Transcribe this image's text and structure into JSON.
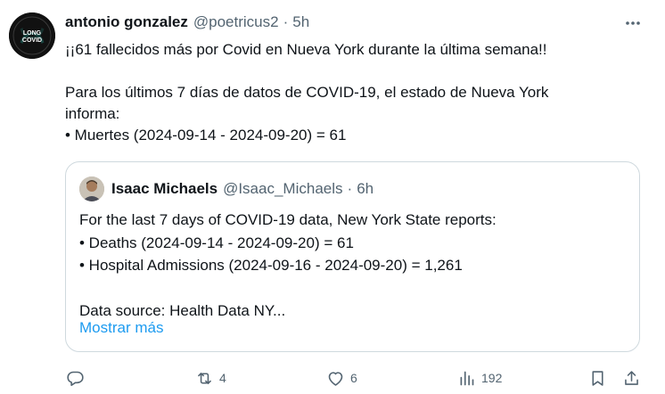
{
  "tweet": {
    "author_name": "antonio gonzalez",
    "author_handle": "@poetricus2",
    "separator": "·",
    "timestamp": "5h",
    "avatar_text": {
      "top": "LONG",
      "bottom": "COVID"
    },
    "text_lines": [
      "¡¡61 fallecidos más por Covid en Nueva York durante la última semana!!",
      "",
      "Para los últimos 7 días de datos de COVID-19, el estado de Nueva York",
      "informa:",
      " • Muertes (2024-09-14 - 2024-09-20) = 61"
    ]
  },
  "quote": {
    "author_name": "Isaac Michaels",
    "author_handle": "@Isaac_Michaels",
    "separator": "·",
    "timestamp": "6h",
    "text_lines": [
      "For the last 7 days of COVID-19 data, New York State reports:",
      "• Deaths (2024-09-14 - 2024-09-20) = 61",
      "• Hospital Admissions (2024-09-16 - 2024-09-20) = 1,261",
      "",
      "Data source: Health Data NY..."
    ],
    "show_more_label": "Mostrar más"
  },
  "actions": {
    "reply_icon": "reply-icon",
    "retweet_count": "4",
    "like_count": "6",
    "views_count": "192",
    "bookmark_icon": "bookmark-icon",
    "share_icon": "share-icon"
  },
  "colors": {
    "text_primary": "#0f1419",
    "text_secondary": "#536471",
    "link": "#1d9bf0",
    "border": "#cfd9de",
    "avatar_accent": "#2ec4b6"
  }
}
